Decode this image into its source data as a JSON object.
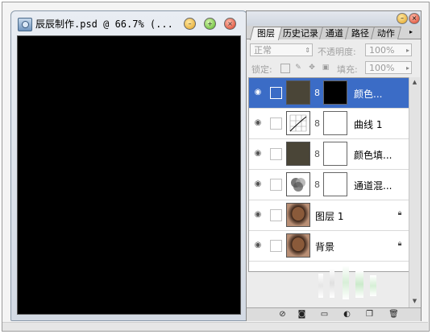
{
  "document_window": {
    "title": "辰辰制作.psd @ 66.7% (...",
    "buttons": {
      "minimize": "–",
      "maximize": "+",
      "close": "×"
    }
  },
  "layers_panel": {
    "tabs": [
      "图层",
      "历史记录",
      "通道",
      "路径",
      "动作"
    ],
    "tab_more": "▸",
    "blend_mode": "正常",
    "opacity_label": "不透明度:",
    "opacity_value": "100%",
    "lock_label": "锁定:",
    "fill_label": "填充:",
    "fill_value": "100%",
    "layers": [
      {
        "name": "颜色...",
        "thumb": "color-fill",
        "mask": "black",
        "selected": true
      },
      {
        "name": "曲线 1",
        "thumb": "curves",
        "mask": "white",
        "selected": false
      },
      {
        "name": "颜色填...",
        "thumb": "color-fill",
        "mask": "white",
        "selected": false
      },
      {
        "name": "通道混...",
        "thumb": "channel-mixer",
        "mask": "white",
        "selected": false
      },
      {
        "name": "图层 1",
        "thumb": "photo",
        "mask": "none",
        "selected": false,
        "locked": true
      },
      {
        "name": "背景",
        "thumb": "photo",
        "mask": "none",
        "selected": false,
        "locked": true
      }
    ],
    "footer_icons": [
      "link-icon",
      "fx-icon",
      "mask-icon",
      "group-icon",
      "adjustment-icon",
      "new-layer-icon",
      "trash-icon"
    ]
  },
  "colors": {
    "selection_blue": "#3b6cc6",
    "canvas": "#000000",
    "swatch_brown": "#4a4537"
  }
}
